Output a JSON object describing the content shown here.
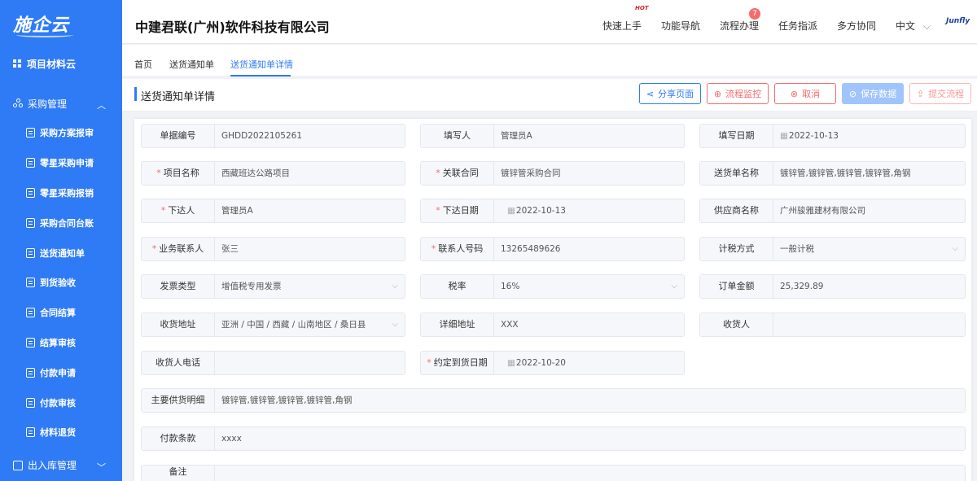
{
  "sidebar": {
    "logo": "施企云",
    "top_item": "项目材料云",
    "purchase_group": "采购管理",
    "items": [
      {
        "label": "采购方案报审"
      },
      {
        "label": "零星采购申请"
      },
      {
        "label": "零星采购报销"
      },
      {
        "label": "采购合同台账"
      },
      {
        "label": "送货通知单"
      },
      {
        "label": "到货验收"
      },
      {
        "label": "合同结算"
      },
      {
        "label": "结算审核"
      },
      {
        "label": "付款申请"
      },
      {
        "label": "付款审核"
      },
      {
        "label": "材料退货"
      }
    ],
    "inout_group": "出入库管理"
  },
  "header": {
    "company": "中建君联(广州)软件科技有限公司",
    "nav": [
      "快速上手",
      "功能导航",
      "流程办理",
      "任务指派",
      "多方协同",
      "中文"
    ],
    "hot_tag": "HOT",
    "badge_count": "7",
    "brand": "Junfly"
  },
  "breadcrumb": [
    "首页",
    "送货通知单",
    "送货通知单详情"
  ],
  "page": {
    "title": "送货通知单详情",
    "buttons": {
      "share": "分享页面",
      "monitor": "流程监控",
      "cancel": "取消",
      "save": "保存数据",
      "submit": "提交流程"
    }
  },
  "form": {
    "doc_no": {
      "label": "单据编号",
      "value": "GHDD2022105261"
    },
    "writer": {
      "label": "填写人",
      "value": "管理员A"
    },
    "write_date": {
      "label": "填写日期",
      "value": "2022-10-13"
    },
    "project": {
      "label": "项目名称",
      "value": "西藏班达公路项目"
    },
    "contract": {
      "label": "关联合同",
      "value": "镀锌管采购合同"
    },
    "delivery_name": {
      "label": "送货单名称",
      "value": "镀锌管,镀锌管,镀锌管,镀锌管,角钢"
    },
    "issuer": {
      "label": "下达人",
      "value": "管理员A"
    },
    "issue_date": {
      "label": "下达日期",
      "value": "2022-10-13"
    },
    "supplier": {
      "label": "供应商名称",
      "value": "广州骏雅建材有限公司"
    },
    "contact": {
      "label": "业务联系人",
      "value": "张三"
    },
    "phone": {
      "label": "联系人号码",
      "value": "13265489626"
    },
    "tax_method": {
      "label": "计税方式",
      "value": "一般计税"
    },
    "invoice_type": {
      "label": "发票类型",
      "value": "增值税专用发票"
    },
    "tax_rate": {
      "label": "税率",
      "value": "16%"
    },
    "order_amount": {
      "label": "订单金额",
      "value": "25,329.89"
    },
    "ship_addr": {
      "label": "收货地址",
      "value": "亚洲 / 中国 / 西藏 / 山南地区 / 桑日县"
    },
    "detail_addr": {
      "label": "详细地址",
      "value": "XXX"
    },
    "receiver": {
      "label": "收货人",
      "value": ""
    },
    "receiver_phone": {
      "label": "收货人电话",
      "value": ""
    },
    "arrival_date": {
      "label": "约定到货日期",
      "value": "2022-10-20"
    },
    "supply_detail": {
      "label": "主要供货明细",
      "value": "镀锌管,镀锌管,镀锌管,镀锌管,角钢"
    },
    "payment_terms": {
      "label": "付款条款",
      "value": "xxxx"
    },
    "remark": {
      "label": "备注",
      "value": ""
    }
  },
  "colors": {
    "primary": "#2f7bf5",
    "danger": "#f56c6c",
    "disabled": "#a0c4fb"
  }
}
